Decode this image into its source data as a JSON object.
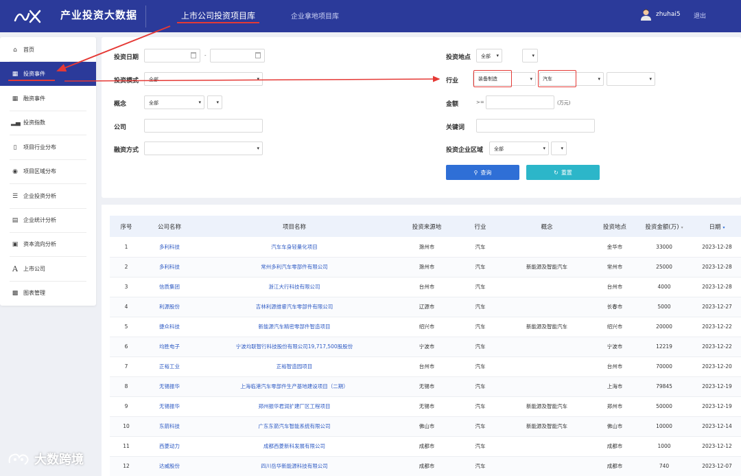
{
  "header": {
    "app_title": "产业投资大数据",
    "tabs": [
      {
        "label": "上市公司投资项目库",
        "active": true
      },
      {
        "label": "企业拿地项目库",
        "active": false
      }
    ],
    "user_name": "zhuhai5",
    "logout_label": "退出"
  },
  "sidebar": {
    "items": [
      {
        "label": "首页",
        "icon": "home-icon"
      },
      {
        "label": "投资事件",
        "icon": "table-icon",
        "active": true
      },
      {
        "label": "融资事件",
        "icon": "table-icon"
      },
      {
        "label": "投资指数",
        "icon": "bar-chart-icon"
      },
      {
        "label": "项目行业分布",
        "icon": "phone-icon"
      },
      {
        "label": "项目区域分布",
        "icon": "globe-icon"
      },
      {
        "label": "企业投资分析",
        "icon": "list-icon"
      },
      {
        "label": "企业统计分析",
        "icon": "server-icon"
      },
      {
        "label": "资本流向分析",
        "icon": "money-icon"
      },
      {
        "label": "上市公司",
        "icon": "font-icon"
      },
      {
        "label": "图表管理",
        "icon": "image-icon"
      }
    ]
  },
  "filters": {
    "invest_date_label": "投资日期",
    "date_separator": "-",
    "invest_mode_label": "投资模式",
    "invest_mode_value": "全部",
    "concept_label": "概念",
    "concept_value": "全部",
    "company_label": "公司",
    "financing_label": "融资方式",
    "location_label": "投资地点",
    "location_value": "全部",
    "industry_label": "行业",
    "industry_value_1": "装备制造",
    "industry_value_2": "汽车",
    "amount_label": "金额",
    "amount_op": ">=",
    "amount_unit": "(万元)",
    "keyword_label": "关键词",
    "region_label": "投资企业区域",
    "region_value": "全部",
    "query_label": "查询",
    "reset_label": "重置"
  },
  "table": {
    "columns": [
      "序号",
      "公司名称",
      "项目名称",
      "投资来源地",
      "行业",
      "概念",
      "投资地点",
      "投资金额(万)",
      "日期"
    ],
    "rows": [
      [
        "1",
        "多利科技",
        "汽车车身轻量化项目",
        "滁州市",
        "汽车",
        "",
        "金华市",
        "33000",
        "2023-12-28"
      ],
      [
        "2",
        "多利科技",
        "常州多利汽车零部件有限公司",
        "滁州市",
        "汽车",
        "新能源及智能汽车",
        "常州市",
        "25000",
        "2023-12-28"
      ],
      [
        "3",
        "信质集团",
        "浙江大行科技有限公司",
        "台州市",
        "汽车",
        "",
        "台州市",
        "4000",
        "2023-12-28"
      ],
      [
        "4",
        "利源股份",
        "吉林利源维睿汽车零部件有限公司",
        "辽源市",
        "汽车",
        "",
        "长春市",
        "5000",
        "2023-12-27"
      ],
      [
        "5",
        "捷众科技",
        "新能源汽车精密零部件智造项目",
        "绍兴市",
        "汽车",
        "新能源及智能汽车",
        "绍兴市",
        "20000",
        "2023-12-22"
      ],
      [
        "6",
        "均胜电子",
        "宁波均联智行科技股份有限公司19,717,500股股份",
        "宁波市",
        "汽车",
        "",
        "宁波市",
        "12219",
        "2023-12-22"
      ],
      [
        "7",
        "正裕工业",
        "正裕智造园项目",
        "台州市",
        "汽车",
        "",
        "台州市",
        "70000",
        "2023-12-20"
      ],
      [
        "8",
        "无锡振华",
        "上海临港汽车零部件生产基地建设项目（二期）",
        "无锡市",
        "汽车",
        "",
        "上海市",
        "79845",
        "2023-12-19"
      ],
      [
        "9",
        "无锡振华",
        "郑州振华君润扩建厂区工程项目",
        "无锡市",
        "汽车",
        "新能源及智能汽车",
        "郑州市",
        "50000",
        "2023-12-19"
      ],
      [
        "10",
        "东箭科技",
        "广东东箭汽车智能系统有限公司",
        "佛山市",
        "汽车",
        "新能源及智能汽车",
        "佛山市",
        "10000",
        "2023-12-14"
      ],
      [
        "11",
        "西菱动力",
        "成都西菱新科发展有限公司",
        "成都市",
        "汽车",
        "",
        "成都市",
        "1000",
        "2023-12-12"
      ],
      [
        "12",
        "达威股份",
        "四川岳华新能源科技有限公司",
        "成都市",
        "汽车",
        "",
        "成都市",
        "740",
        "2023-12-07"
      ]
    ]
  },
  "watermark": {
    "text": "大数跨境"
  },
  "colors": {
    "brand": "#2b3a9a",
    "highlight": "#e53935",
    "query": "#2f6fd6",
    "reset": "#2cb6c9",
    "link": "#2f5bc4"
  }
}
